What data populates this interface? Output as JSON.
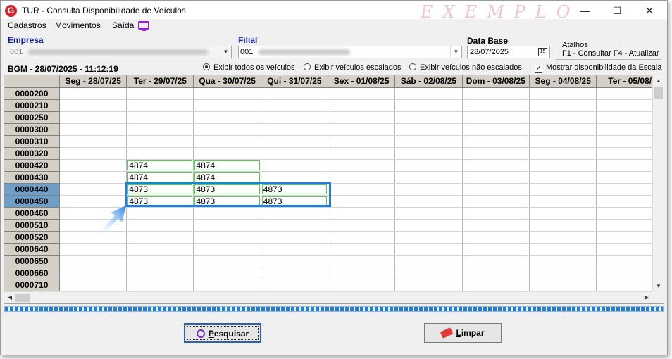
{
  "window": {
    "title": "TUR - Consulta Disponibilidade de Veículos",
    "watermark": "EXEMPLO",
    "app_icon": "G",
    "controls": {
      "minimize": "—",
      "maximize": "☐",
      "close": "✕"
    }
  },
  "menu": {
    "items": [
      "Cadastros",
      "Movimentos",
      "Saída"
    ],
    "icon": "monitor-icon"
  },
  "filters": {
    "empresa_label": "Empresa",
    "empresa_value": "001",
    "filial_label": "Filial",
    "filial_value": "001",
    "data_base_label": "Data Base",
    "data_base_value": "28/07/2025",
    "atalhos_title": "Atalhos",
    "atalhos_text": "F1 - Consultar  F4 - Atualizar"
  },
  "bgm": "BGM - 28/07/2025 - 11:12:19",
  "options": {
    "radio1": "Exibir todos os veículos",
    "radio2": "Exibir veículos escalados",
    "radio3": "Exibir veículos não escalados",
    "selected_radio": "radio1",
    "checkbox": "Mostrar disponibilidade da Escala",
    "checkbox_checked": true
  },
  "grid": {
    "columns": [
      "Seg - 28/07/25",
      "Ter - 29/07/25",
      "Qua - 30/07/25",
      "Qui - 31/07/25",
      "Sex - 01/08/25",
      "Sáb - 02/08/25",
      "Dom - 03/08/25",
      "Seg - 04/08/25",
      "Ter - 05/08/"
    ],
    "rows": [
      {
        "id": "0000200",
        "cells": [
          "",
          "",
          "",
          "",
          "",
          "",
          "",
          "",
          ""
        ]
      },
      {
        "id": "0000210",
        "cells": [
          "",
          "",
          "",
          "",
          "",
          "",
          "",
          "",
          ""
        ]
      },
      {
        "id": "0000250",
        "cells": [
          "",
          "",
          "",
          "",
          "",
          "",
          "",
          "",
          ""
        ]
      },
      {
        "id": "0000300",
        "cells": [
          "",
          "",
          "",
          "",
          "",
          "",
          "",
          "",
          ""
        ]
      },
      {
        "id": "0000310",
        "cells": [
          "",
          "",
          "",
          "",
          "",
          "",
          "",
          "",
          ""
        ]
      },
      {
        "id": "0000320",
        "cells": [
          "",
          "",
          "",
          "",
          "",
          "",
          "",
          "",
          ""
        ]
      },
      {
        "id": "0000420",
        "cells": [
          "",
          "4874",
          "4874",
          "",
          "",
          "",
          "",
          "",
          ""
        ]
      },
      {
        "id": "0000430",
        "cells": [
          "",
          "4874",
          "4874",
          "",
          "",
          "",
          "",
          "",
          ""
        ]
      },
      {
        "id": "0000440",
        "cells": [
          "",
          "4873",
          "4873",
          "4873",
          "",
          "",
          "",
          "",
          ""
        ],
        "selected": true
      },
      {
        "id": "0000450",
        "cells": [
          "",
          "4873",
          "4873",
          "4873",
          "",
          "",
          "",
          "",
          ""
        ],
        "selected": true
      },
      {
        "id": "0000460",
        "cells": [
          "",
          "",
          "",
          "",
          "",
          "",
          "",
          "",
          ""
        ]
      },
      {
        "id": "0000510",
        "cells": [
          "",
          "",
          "",
          "",
          "",
          "",
          "",
          "",
          ""
        ]
      },
      {
        "id": "0000520",
        "cells": [
          "",
          "",
          "",
          "",
          "",
          "",
          "",
          "",
          ""
        ]
      },
      {
        "id": "0000640",
        "cells": [
          "",
          "",
          "",
          "",
          "",
          "",
          "",
          "",
          ""
        ]
      },
      {
        "id": "0000650",
        "cells": [
          "",
          "",
          "",
          "",
          "",
          "",
          "",
          "",
          ""
        ]
      },
      {
        "id": "0000660",
        "cells": [
          "",
          "",
          "",
          "",
          "",
          "",
          "",
          "",
          ""
        ]
      },
      {
        "id": "0000710",
        "cells": [
          "",
          "",
          "",
          "",
          "",
          "",
          "",
          "",
          ""
        ]
      }
    ]
  },
  "buttons": {
    "pesquisar_first": "P",
    "pesquisar_rest": "esquisar",
    "limpar_first": "L",
    "limpar_rest": "impar"
  },
  "colors": {
    "accent": "#1f7ee3",
    "cell_border": "#55cc55",
    "selected_row_header": "#6f9fc6",
    "watermark": "#f3c5c5"
  }
}
